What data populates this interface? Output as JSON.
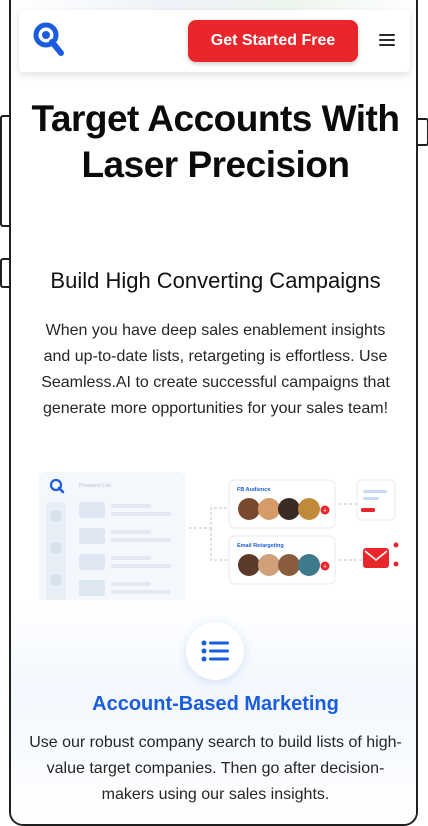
{
  "header": {
    "logo_icon": "seamless-logo-icon",
    "cta_label": "Get Started Free",
    "menu_icon": "hamburger-menu-icon",
    "brand_color": "#1a5ce0",
    "cta_color": "#e8262b"
  },
  "hero": {
    "title": "Target Accounts With Laser Precision",
    "subtitle": "Build High Converting Campaigns",
    "description": "When you have deep sales enablement insights and up-to-date lists, retargeting is effortless. Use Seamless.AI to create successful campaigns that generate more opportunities for your sales team!"
  },
  "illustration": {
    "prospect_list_label": "Prospect List",
    "fb_audience_label": "FB Audience",
    "email_retargeting_label": "Email Retargeting"
  },
  "feature": {
    "icon": "list-icon",
    "title": "Account-Based Marketing",
    "description": "Use our robust company search to build lists of high-value target companies. Then go after decision-makers using our sales insights."
  }
}
